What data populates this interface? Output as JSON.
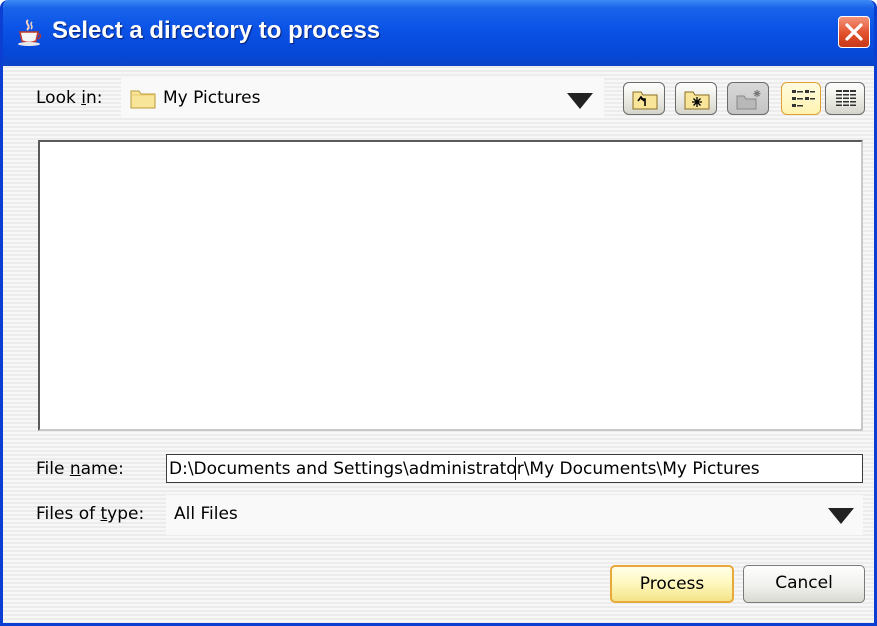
{
  "window": {
    "title": "Select a directory to process"
  },
  "look_in": {
    "label_pre": "Look ",
    "label_mnemonic": "i",
    "label_post": "n:",
    "value": "My Pictures",
    "value_icon": "folder-icon"
  },
  "toolbar": {
    "buttons": [
      "up-one-level-icon",
      "home-folder-icon",
      "new-folder-icon",
      "list-view-icon",
      "details-view-icon"
    ]
  },
  "file_name": {
    "label_pre": "File ",
    "label_mnemonic": "n",
    "label_post": "ame:",
    "value": "D:\\Documents and Settings\\administrator\\My Documents\\My Pictures"
  },
  "files_of_type": {
    "label_pre": "Files of ",
    "label_mnemonic": "t",
    "label_post": "ype:",
    "value": "All Files"
  },
  "buttons": {
    "process": "Process",
    "cancel": "Cancel"
  }
}
